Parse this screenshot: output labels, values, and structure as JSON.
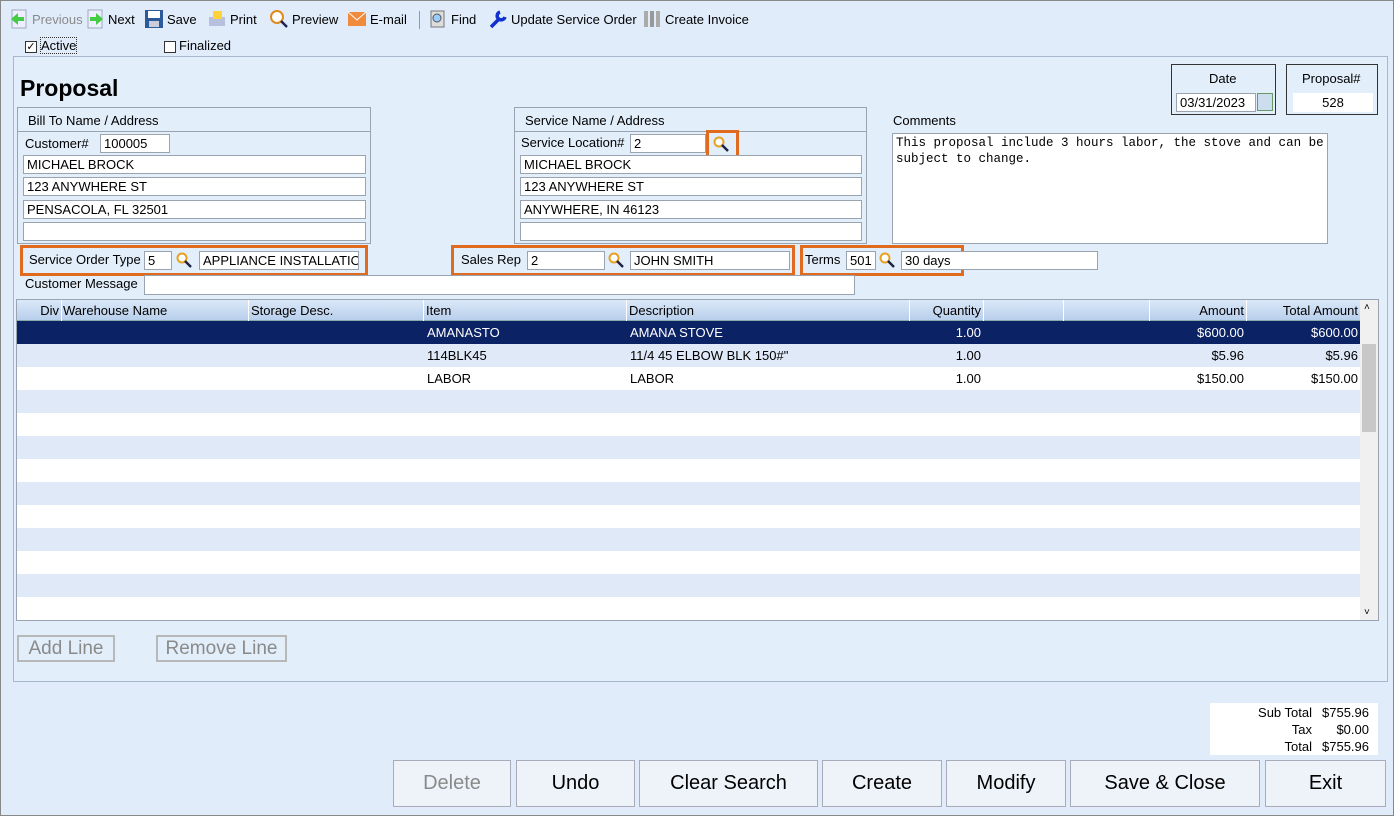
{
  "toolbar": {
    "previous": "Previous",
    "next": "Next",
    "save": "Save",
    "print": "Print",
    "preview": "Preview",
    "email": "E-mail",
    "find": "Find",
    "update_service_order": "Update Service Order",
    "create_invoice": "Create Invoice"
  },
  "flags": {
    "active": "Active",
    "active_checked": true,
    "finalized": "Finalized",
    "finalized_checked": false
  },
  "title": "Proposal",
  "date": {
    "label": "Date",
    "value": "03/31/2023"
  },
  "proposal": {
    "label": "Proposal#",
    "value": "528"
  },
  "bill_to": {
    "header": "Bill To Name / Address",
    "customer_label": "Customer#",
    "customer": "100005",
    "name": "MICHAEL BROCK",
    "address1": "123 ANYWHERE ST",
    "city": "PENSACOLA, FL  32501",
    "address2": ""
  },
  "service": {
    "header": "Service Name / Address",
    "location_label": "Service Location#",
    "location": "2",
    "name": "MICHAEL BROCK",
    "address1": "123 ANYWHERE ST",
    "city": "ANYWHERE, IN  46123",
    "address2": ""
  },
  "comments": {
    "label": "Comments",
    "value": "This proposal include 3 hours labor, the stove and can be subject to change."
  },
  "service_order_type": {
    "label": "Service Order Type",
    "code": "5",
    "name": "APPLIANCE INSTALLATIO"
  },
  "sales_rep": {
    "label": "Sales Rep",
    "code": "2",
    "name": "JOHN SMITH"
  },
  "terms": {
    "label": "Terms",
    "code": "501",
    "name": "30 days",
    "extra": ""
  },
  "customer_message": {
    "label": "Customer Message",
    "value": ""
  },
  "grid": {
    "columns": [
      "Div",
      "Warehouse Name",
      "Storage Desc.",
      "Item",
      "Description",
      "Quantity",
      "",
      "",
      "Amount",
      "Total Amount"
    ],
    "rows": [
      {
        "item": "AMANASTO",
        "description": "AMANA STOVE",
        "quantity": "1.00",
        "amount": "$600.00",
        "total": "$600.00",
        "selected": true
      },
      {
        "item": "114BLK45",
        "description": "11/4 45 ELBOW BLK 150#\"",
        "quantity": "1.00",
        "amount": "$5.96",
        "total": "$5.96"
      },
      {
        "item": "LABOR",
        "description": "LABOR",
        "quantity": "1.00",
        "amount": "$150.00",
        "total": "$150.00"
      }
    ]
  },
  "line_buttons": {
    "add": "Add Line",
    "remove": "Remove Line"
  },
  "totals": {
    "subtotal_label": "Sub Total",
    "subtotal": "$755.96",
    "tax_label": "Tax",
    "tax": "$0.00",
    "total_label": "Total",
    "total": "$755.96"
  },
  "buttons": {
    "delete": "Delete",
    "undo": "Undo",
    "clear_search": "Clear Search",
    "create": "Create",
    "modify": "Modify",
    "save_close": "Save & Close",
    "exit": "Exit"
  },
  "colors": {
    "highlight": "#e06a1e",
    "selected_row": "#0b2265",
    "alt_row": "#dfe9f8"
  }
}
